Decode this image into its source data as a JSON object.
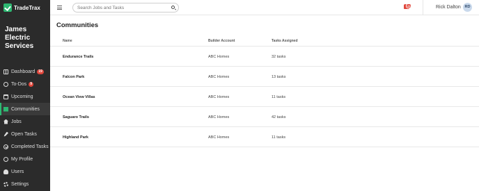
{
  "brand": {
    "name": "TradeTrax"
  },
  "company": {
    "name": "James Electric Services"
  },
  "sidebar": {
    "items": [
      {
        "label": "Dashboard",
        "badge": "19",
        "icon": "dashboard-icon"
      },
      {
        "label": "To-Dos",
        "badge": "9",
        "icon": "check-circle-icon"
      },
      {
        "label": "Upcoming",
        "icon": "calendar-icon"
      },
      {
        "label": "Communities",
        "icon": "building-icon",
        "active": true
      },
      {
        "label": "Jobs",
        "icon": "home-icon"
      },
      {
        "label": "Open Tasks",
        "icon": "wrench-icon"
      },
      {
        "label": "Completed Tasks",
        "icon": "check-done-icon"
      },
      {
        "label": "My Profile",
        "icon": "user-circle-icon"
      },
      {
        "label": "Users",
        "icon": "users-icon"
      },
      {
        "label": "Settings",
        "icon": "gear-icon"
      }
    ]
  },
  "header": {
    "search_placeholder": "Search Jobs and Tasks",
    "notification_count": "24",
    "user_name": "Rick Dalton",
    "avatar_initials": "RD"
  },
  "main": {
    "title": "Communities",
    "columns": [
      "Name",
      "Builder Account",
      "Tasks Assigned"
    ],
    "rows": [
      {
        "name": "Endurance Trails",
        "builder": "ABC Homes",
        "tasks": "32 tasks"
      },
      {
        "name": "Falcon Park",
        "builder": "ABC Homes",
        "tasks": "13 tasks"
      },
      {
        "name": "Ocean View Villas",
        "builder": "ABC Homes",
        "tasks": "11 tasks"
      },
      {
        "name": "Saguaro Trails",
        "builder": "ABC Homes",
        "tasks": "42 tasks"
      },
      {
        "name": "Highland Park",
        "builder": "ABC Homes",
        "tasks": "11 tasks"
      }
    ]
  },
  "colors": {
    "accent": "#2eb872",
    "sidebar_bg": "#2b2b2b",
    "badge": "#e0463b"
  }
}
